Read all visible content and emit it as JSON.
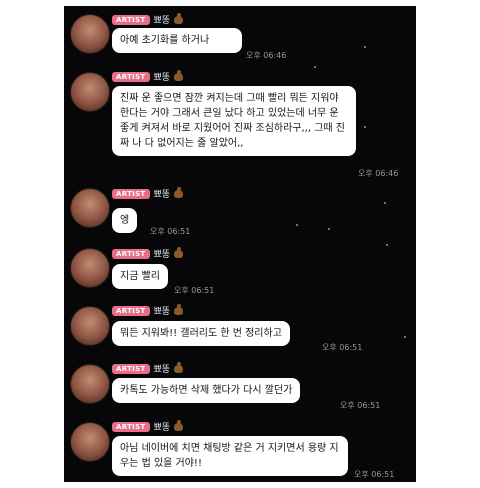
{
  "badge": "ARTIST",
  "sender": "뾰똥",
  "messages": [
    {
      "text": "아예 초기화를 하거나",
      "time": "오후 06:46"
    },
    {
      "text": "진짜 운 좋으면 잠깐 켜지는데 그때 빨리 뭐든 지워야 한다는 거야 그래서 큰일 났다 하고 있었는데 너무 운 좋게 켜져서 바로 지웠어어 진짜 조심하라구,,, 그때 진짜 나 다 없어지는 줄 알았어,,",
      "time": "오후 06:46"
    },
    {
      "text": "엥",
      "time": "오후 06:51"
    },
    {
      "text": "지금 빨리",
      "time": "오후 06:51"
    },
    {
      "text": "뭐든 지워봐!! 갤러리도 한 번 정리하고",
      "time": "오후 06:51"
    },
    {
      "text": "카톡도 가능하면 삭제 했다가 다시 깔던가",
      "time": "오후 06:51"
    },
    {
      "text": "아님 네이버에 치면 채팅방 같은 거 지키면서 용량 지우는 법 있을 거야!!",
      "time": "오후 06:51"
    }
  ]
}
